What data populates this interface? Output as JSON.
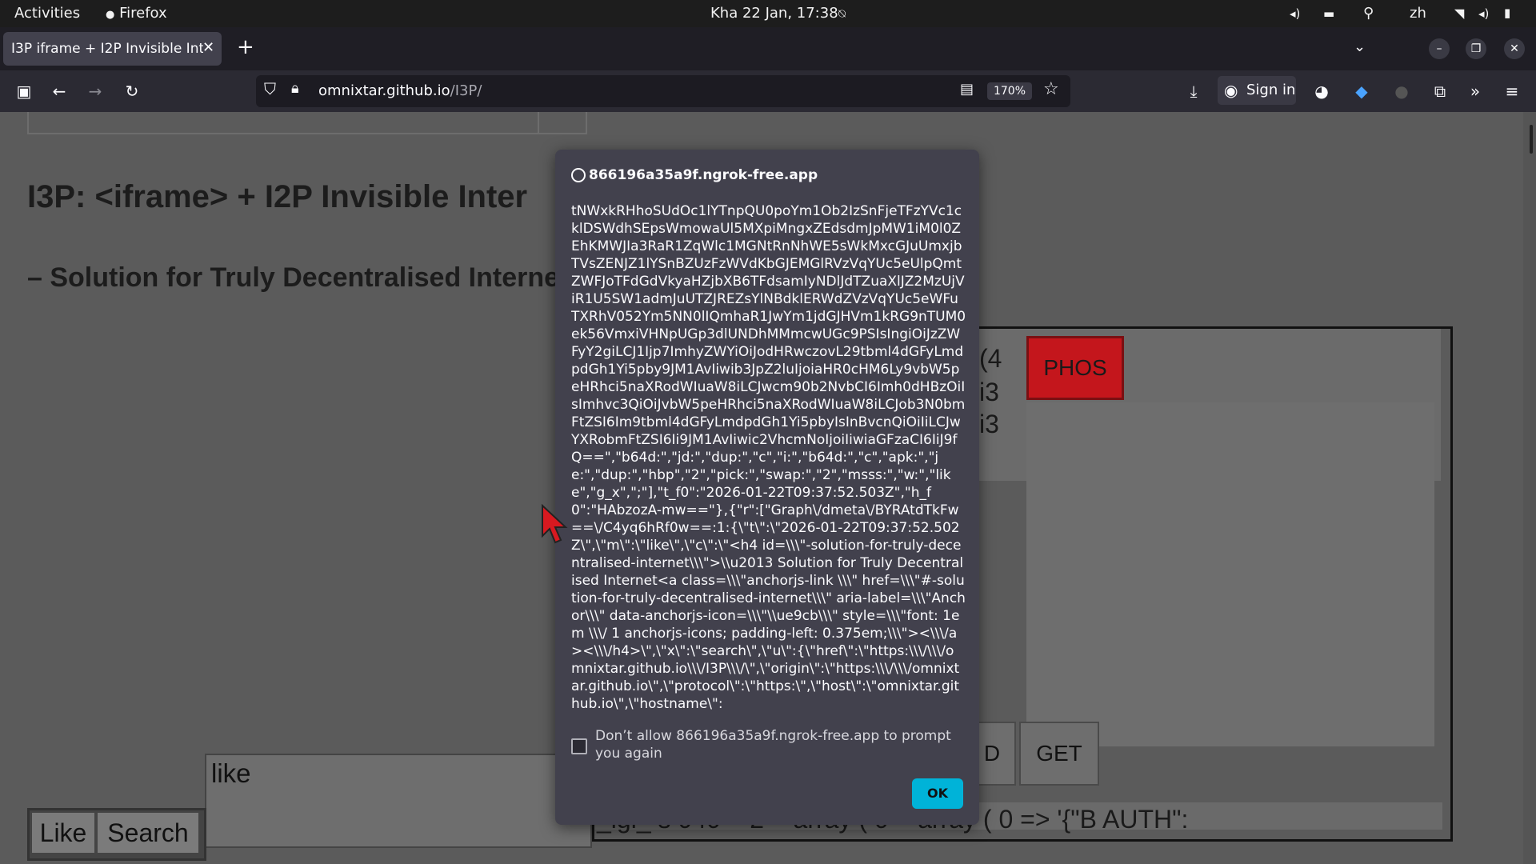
{
  "topbar": {
    "activities": "Activities",
    "app_name": "Firefox",
    "clock": "Kha 22 Jan, 17:38",
    "input_method": "zh"
  },
  "browser": {
    "tab_title": "I3P iframe + I2P Invisible Inte",
    "url_host": "omnixtar.github.io",
    "url_path": "/I3P/",
    "zoom": "170%",
    "sign_in": "Sign in"
  },
  "page": {
    "heading": "I3P: <iframe> + I2P Invisible Inter",
    "subheading": "– Solution for Truly Decentralised Interne",
    "iframe_fragments": {
      "phos_button": "PHOS",
      "frag1": "(4",
      "frag2": "i3",
      "frag3": "i3",
      "frag_d": "D",
      "get_button": "GET",
      "bottom_text": "_igi_ s 040 = 2 = array ( 0 = array ( 0 => '{\"B  AUTH\":"
    },
    "textarea_value": "like",
    "like_button": "Like",
    "search_button": "Search"
  },
  "dialog": {
    "origin": "866196a35a9f.ngrok-free.app",
    "message": "tNWxkRHhoSUdOc1lYTnpQU0poYm1Ob2IzSnFjeTFzYVc1cklDSWdhSEpsWmowaUl5MXpiMngxZEdsdmJpMW1iM0l0ZEhKMWJIa3RaR1ZqWlc1MGNtRnNhWE5sWkMxcGJuUmxjbTVsZENJZ1lYSnBZUzFzWVdKbGJEMGlRVzVqYUc5eUlpQmtZWFJoTFdGdVkyaHZjbXB6TFdsamIyNDlJdTZuaXlJZ2MzUjViR1U5SW1admJuUTZJREZsYlNBdklERWdZVzVqYUc5eWFuTXRhV052Ym5NN0lIQmhaR1JwYm1jdGJHVm1kRG9nTUM0ek56VmxiVHNpUGp3dlUNDhMMmcwUGc9PSIsIngiOiJzZWFyY2giLCJ1Ijp7ImhyZWYiOiJodHRwczovL29tbml4dGFyLmdpdGh1Yi5pby9JM1AvIiwib3JpZ2luIjoiaHR0cHM6Ly9vbW5peHRhci5naXRodWIuaW8iLCJwcm90b2NvbCI6Imh0dHBzOiIsImhvc3QiOiJvbW5peHRhci5naXRodWIuaW8iLCJob3N0bmFtZSI6Im9tbml4dGFyLmdpdGh1Yi5pbyIsInBvcnQiOiIiLCJwYXRobmFtZSI6Ii9JM1AvIiwic2VhcmNoIjoiIiwiaGFzaCI6IiJ9fQ==\",\"b64d:\",\"jd:\",\"dup:\",\"c\",\"i:\",\"b64d:\",\"c\",\"apk:\",\"je:\",\"dup:\",\"hbp\",\"2\",\"pick:\",\"swap:\",\"2\",\"msss:\",\"w:\",\"like\",\"g_x\",\";\"],\"t_f0\":\"2026-01-22T09:37:52.503Z\",\"h_f0\":\"HAbzozA-mw==\"},{\"r\":[\"Graph\\/dmeta\\/BYRAtdTkFw==\\/C4yq6hRf0w==:1:{\\\"t\\\":\\\"2026-01-22T09:37:52.502Z\\\",\\\"m\\\":\\\"like\\\",\\\"c\\\":\\\"<h4 id=\\\\\\\"-solution-for-truly-decentralised-internet\\\\\\\">\\\\u2013 Solution for Truly Decentralised Internet<a class=\\\\\\\"anchorjs-link \\\\\\\" href=\\\\\\\"#-solution-for-truly-decentralised-internet\\\\\\\" aria-label=\\\\\\\"Anchor\\\\\\\" data-anchorjs-icon=\\\\\\\"\\\\ue9cb\\\\\\\" style=\\\\\\\"font: 1em \\\\\\/ 1 anchorjs-icons; padding-left: 0.375em;\\\\\\\"><\\\\\\/a><\\\\\\/h4>\\\",\\\"x\\\":\\\"search\\\",\\\"u\\\":{\\\"href\\\":\\\"https:\\\\\\/\\\\\\/omnixtar.github.io\\\\\\/I3P\\\\\\/\\\",\\\"origin\\\":\\\"https:\\\\\\/\\\\\\/omnixtar.github.io\\\",\\\"protocol\\\":\\\"https:\\\",\\\"host\\\":\\\"omnixtar.github.io\\\",\\\"hostname\\\":",
    "checkbox_label": "Don’t allow 866196a35a9f.ngrok-free.app to prompt you again",
    "ok_label": "OK"
  },
  "colors": {
    "dialog_bg": "#42414d",
    "ok_button": "#00b3d8",
    "phos_button": "#c4161c",
    "page_bg": "#5b5b5b"
  }
}
